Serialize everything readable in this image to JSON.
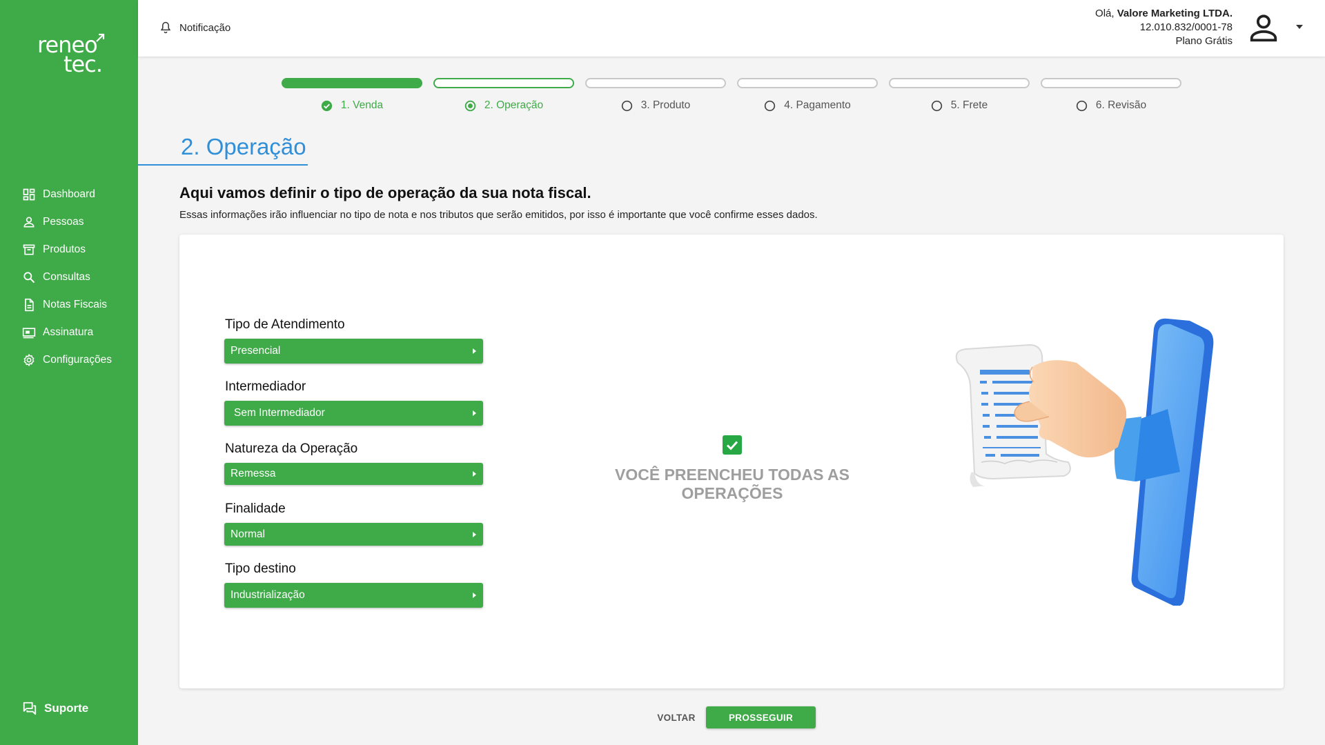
{
  "brand": {
    "logo_line1": "reneo",
    "logo_line2": "tec.",
    "primary_color": "#3faa48",
    "accent_blue": "#2f8fd8"
  },
  "sidebar": {
    "items": [
      {
        "label": "Dashboard",
        "icon": "dashboard-icon"
      },
      {
        "label": "Pessoas",
        "icon": "person-icon"
      },
      {
        "label": "Produtos",
        "icon": "archive-icon"
      },
      {
        "label": "Consultas",
        "icon": "search-icon"
      },
      {
        "label": "Notas Fiscais",
        "icon": "document-icon"
      },
      {
        "label": "Assinatura",
        "icon": "payment-icon"
      },
      {
        "label": "Configurações",
        "icon": "gear-icon"
      }
    ],
    "support_label": "Suporte"
  },
  "topbar": {
    "notification_label": "Notificação",
    "greeting": "Olá,",
    "company": "Valore Marketing LTDA.",
    "cnpj": "12.010.832/0001-78",
    "plan": "Plano Grátis"
  },
  "stepper": {
    "steps": [
      {
        "label": "1. Venda",
        "status": "done"
      },
      {
        "label": "2. Operação",
        "status": "active"
      },
      {
        "label": "3. Produto",
        "status": "pending"
      },
      {
        "label": "4. Pagamento",
        "status": "pending"
      },
      {
        "label": "5. Frete",
        "status": "pending"
      },
      {
        "label": "6. Revisão",
        "status": "pending"
      }
    ]
  },
  "main": {
    "section_title": "2. Operação",
    "headline": "Aqui vamos definir o tipo de operação da sua nota fiscal.",
    "subtitle": "Essas informações irão influenciar no tipo de nota e nos tributos que serão emitidos, por isso é importante que você confirme esses dados.",
    "fields": [
      {
        "label": "Tipo de Atendimento",
        "value": "Presencial"
      },
      {
        "label": "Intermediador",
        "value": "Sem Intermediador"
      },
      {
        "label": "Natureza da Operação",
        "value": "Remessa"
      },
      {
        "label": "Finalidade",
        "value": "Normal"
      },
      {
        "label": "Tipo destino",
        "value": "Industrialização"
      }
    ],
    "completion_text": "VOCÊ PREENCHEU TODAS AS OPERAÇÕES"
  },
  "footer": {
    "back_label": "VOLTAR",
    "next_label": "PROSSEGUIR"
  }
}
